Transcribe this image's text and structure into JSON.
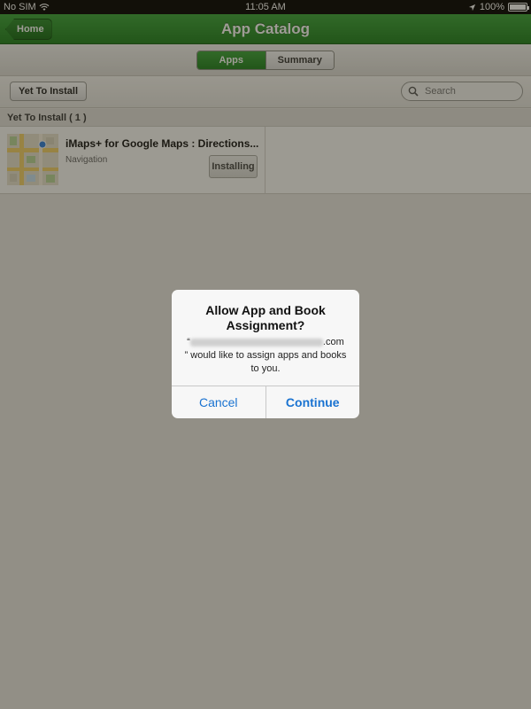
{
  "status_bar": {
    "carrier": "No SIM",
    "time": "11:05 AM",
    "battery": "100%",
    "battery_level": 1.0,
    "icons": [
      "wifi-icon",
      "location-arrow-icon",
      "battery-icon"
    ]
  },
  "navbar": {
    "title": "App Catalog",
    "back_label": "Home",
    "color": "#2a8f2a"
  },
  "segments": {
    "items": [
      "Apps",
      "Summary"
    ],
    "selected": "Apps"
  },
  "toolbar": {
    "filter_label": "Yet To Install",
    "search_placeholder": "Search"
  },
  "section": {
    "header": "Yet To Install ( 1 )"
  },
  "apps": [
    {
      "name": "iMaps+ for Google Maps : Directions...",
      "category": "Navigation",
      "action": "Installing"
    }
  ],
  "alert": {
    "title": "Allow App and Book Assignment?",
    "message_open_quote": "“",
    "message_domain_suffix": ".com",
    "message_rest": "” would like to assign apps and books to you.",
    "cancel_label": "Cancel",
    "continue_label": "Continue",
    "button_color": "#1a73d1"
  }
}
